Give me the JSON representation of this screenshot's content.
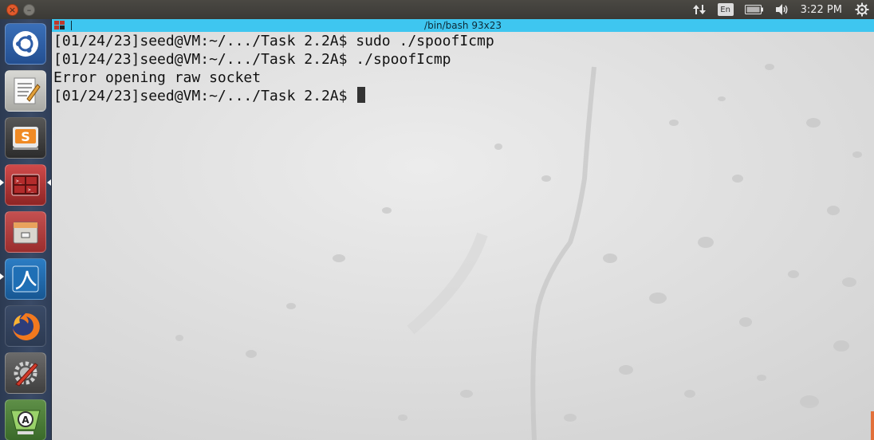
{
  "top_panel": {
    "close_glyph": "×",
    "minimize_glyph": "–",
    "network_icon": "arrows-up-down-icon",
    "language": "En",
    "battery_icon": "battery-icon",
    "volume_icon": "volume-icon",
    "clock": "3:22 PM",
    "settings_icon": "gear-icon"
  },
  "launcher": {
    "items": [
      {
        "name": "ubuntu-dash-icon",
        "running": false
      },
      {
        "name": "text-editor-icon",
        "running": false
      },
      {
        "name": "sublime-text-icon",
        "running": false
      },
      {
        "name": "terminal-app-icon",
        "running": true,
        "focused": true
      },
      {
        "name": "file-manager-icon",
        "running": false
      },
      {
        "name": "wireshark-icon",
        "running": true
      },
      {
        "name": "firefox-icon",
        "running": false
      },
      {
        "name": "system-settings-icon",
        "running": false
      },
      {
        "name": "software-updater-icon",
        "running": false
      }
    ]
  },
  "terminal": {
    "title": "/bin/bash 93x23",
    "lines": [
      "[01/24/23]seed@VM:~/.../Task 2.2A$ sudo ./spoofIcmp",
      "[01/24/23]seed@VM:~/.../Task 2.2A$ ./spoofIcmp",
      "Error opening raw socket",
      "[01/24/23]seed@VM:~/.../Task 2.2A$ "
    ]
  },
  "colors": {
    "titlebar": "#3ec6f0",
    "terminal_bg": "#dedede",
    "panel": "#3b3a36",
    "launcher": "#34435e"
  }
}
